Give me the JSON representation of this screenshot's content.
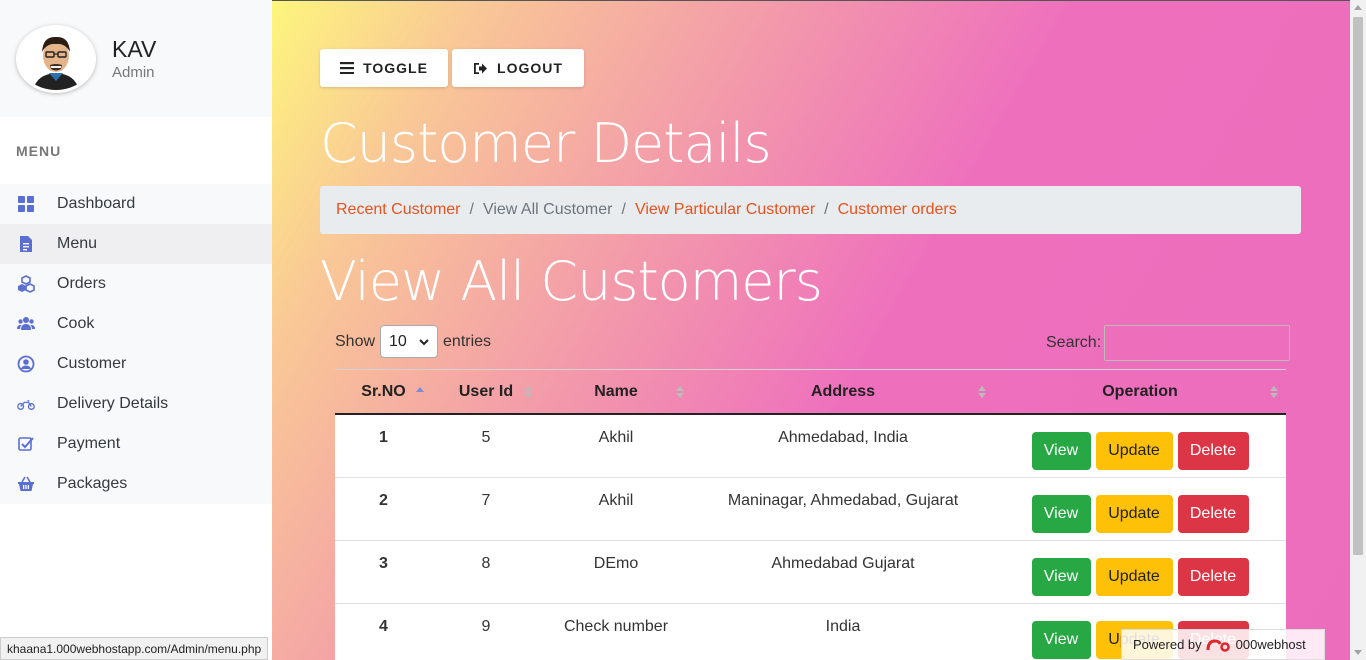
{
  "profile": {
    "name": "KAV",
    "role": "Admin"
  },
  "menu": {
    "heading": "MENU",
    "items": [
      {
        "label": "Dashboard",
        "icon": "dashboard-icon"
      },
      {
        "label": "Menu",
        "icon": "document-icon"
      },
      {
        "label": "Orders",
        "icon": "cubes-icon"
      },
      {
        "label": "Cook",
        "icon": "users-icon"
      },
      {
        "label": "Customer",
        "icon": "user-circle-icon"
      },
      {
        "label": "Delivery Details",
        "icon": "motorcycle-icon"
      },
      {
        "label": "Payment",
        "icon": "check-square-icon"
      },
      {
        "label": "Packages",
        "icon": "basket-icon"
      }
    ]
  },
  "toolbar": {
    "toggle_label": "TOGGLE",
    "logout_label": "LOGOUT"
  },
  "page_title": "Customer Details",
  "breadcrumb": [
    "Recent Customer",
    "View All Customer",
    "View Particular Customer",
    "Customer orders"
  ],
  "section_title": "View All Customers",
  "table_controls": {
    "show_label": "Show",
    "entries_value": "10",
    "entries_label": "entries",
    "search_label": "Search:"
  },
  "table": {
    "columns": [
      "Sr.NO",
      "User Id",
      "Name",
      "Address",
      "Operation"
    ],
    "rows": [
      {
        "sr": "1",
        "user_id": "5",
        "name": "Akhil",
        "address": "Ahmedabad, India"
      },
      {
        "sr": "2",
        "user_id": "7",
        "name": "Akhil",
        "address": "Maninagar, Ahmedabad, Gujarat"
      },
      {
        "sr": "3",
        "user_id": "8",
        "name": "DEmo",
        "address": "Ahmedabad Gujarat"
      },
      {
        "sr": "4",
        "user_id": "9",
        "name": "Check number",
        "address": "India"
      }
    ],
    "actions": {
      "view": "View",
      "update": "Update",
      "delete": "Delete"
    }
  },
  "status_url": "khaana1.000webhostapp.com/Admin/menu.php",
  "powered_by": {
    "prefix": "Powered by",
    "brand": "000webhost"
  },
  "colors": {
    "link": "#e8521e",
    "view": "#28a745",
    "update": "#ffc107",
    "delete": "#dc3545",
    "icon": "#5a6fd1"
  }
}
